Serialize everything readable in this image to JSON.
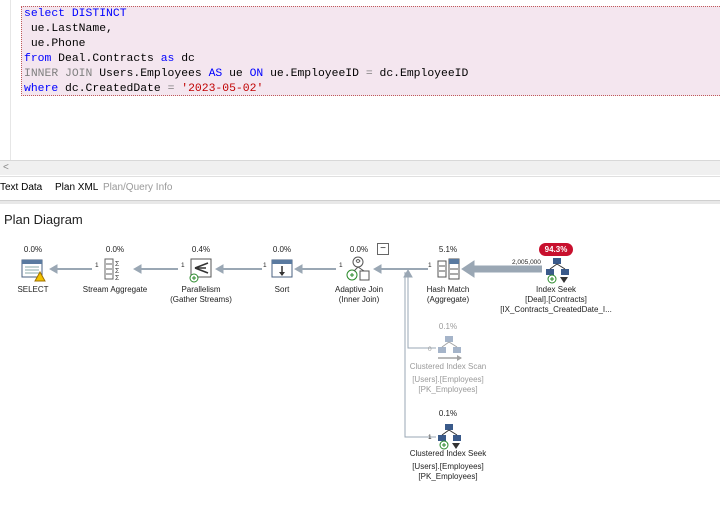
{
  "editor": {
    "lines": [
      {
        "parts": [
          {
            "t": "select DISTINCT",
            "c": "kw"
          }
        ]
      },
      {
        "parts": [
          {
            "t": " ue.LastName,",
            "c": ""
          }
        ]
      },
      {
        "parts": [
          {
            "t": " ue.Phone",
            "c": ""
          }
        ]
      },
      {
        "parts": [
          {
            "t": "from",
            "c": "kw"
          },
          {
            "t": " Deal.Contracts ",
            "c": ""
          },
          {
            "t": "as",
            "c": "kw"
          },
          {
            "t": " dc",
            "c": ""
          }
        ]
      },
      {
        "parts": [
          {
            "t": "INNER JOIN",
            "c": "gray"
          },
          {
            "t": " Users.Employees ",
            "c": ""
          },
          {
            "t": "AS",
            "c": "kw"
          },
          {
            "t": " ue ",
            "c": ""
          },
          {
            "t": "ON",
            "c": "kw"
          },
          {
            "t": " ue.EmployeeID ",
            "c": ""
          },
          {
            "t": "=",
            "c": "gray"
          },
          {
            "t": " dc.EmployeeID",
            "c": ""
          }
        ]
      },
      {
        "parts": [
          {
            "t": "where",
            "c": "kw"
          },
          {
            "t": " dc.CreatedDate ",
            "c": ""
          },
          {
            "t": "=",
            "c": "gray"
          },
          {
            "t": " ",
            "c": ""
          },
          {
            "t": "'2023-05-02'",
            "c": "str"
          }
        ]
      }
    ],
    "scroll_left_glyph": "<"
  },
  "tabs": {
    "text_data": "Text Data",
    "plan_xml": "Plan XML",
    "plan_query_info": "Plan/Query Info"
  },
  "plan": {
    "title": "Plan Diagram",
    "collapse_glyph": "−",
    "nodes": {
      "select": {
        "cost": "0.0%",
        "label": "SELECT"
      },
      "stream_aggregate": {
        "cost": "0.0%",
        "label": "Stream Aggregate"
      },
      "parallelism": {
        "cost": "0.4%",
        "label": "Parallelism",
        "sub": "(Gather Streams)"
      },
      "sort": {
        "cost": "0.0%",
        "label": "Sort"
      },
      "adaptive_join": {
        "cost": "0.0%",
        "label": "Adaptive Join",
        "sub": "(Inner Join)"
      },
      "hash_match": {
        "cost": "5.1%",
        "label": "Hash Match",
        "sub": "(Aggregate)"
      },
      "index_seek_contracts": {
        "cost": "94.3%",
        "label": "Index Seek",
        "sub": "[Deal].[Contracts]",
        "sub2": "[IX_Contracts_CreatedDate_I..."
      },
      "clustered_index_scan": {
        "cost": "0.1%",
        "label": "Clustered Index Scan",
        "sub": "[Users].[Employees]",
        "sub2": "[PK_Employees]"
      },
      "clustered_index_seek": {
        "cost": "0.1%",
        "label": "Clustered Index Seek",
        "sub": "[Users].[Employees]",
        "sub2": "[PK_Employees]"
      }
    },
    "row_counts": {
      "select_in": "1",
      "stream_in": "1",
      "parallelism_in": "1",
      "sort_in": "1",
      "adaptive_in": "1",
      "hash_in": "2,005,000",
      "scan_in": "0",
      "seek_in": "1"
    }
  }
}
